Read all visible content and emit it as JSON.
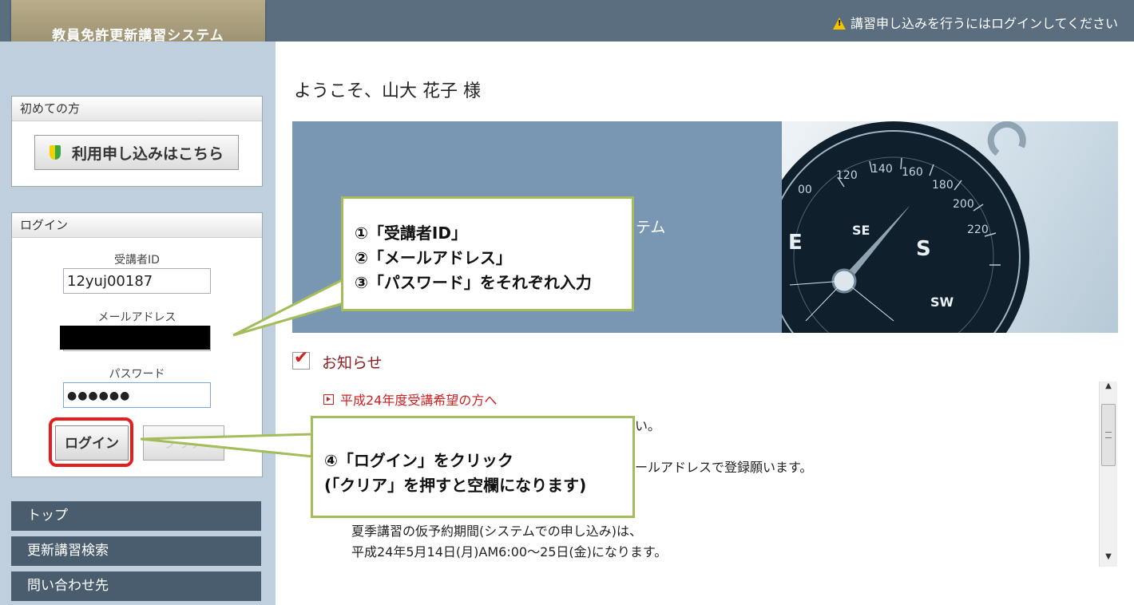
{
  "app": {
    "title": "教員免許更新講習システム"
  },
  "header": {
    "notice": "講習申し込みを行うにはログインしてください",
    "notice_icon": "warning-icon"
  },
  "sidebar": {
    "first_time": {
      "heading": "初めての方",
      "apply_button": "利用申し込みはこちら",
      "apply_icon": "beginner-mark-icon"
    },
    "login": {
      "heading": "ログイン",
      "id_label": "受講者ID",
      "id_value": "12yuj00187",
      "email_label": "メールアドレス",
      "email_value": "",
      "password_label": "パスワード",
      "password_value": "●●●●●●",
      "login_button": "ログイン",
      "clear_button": "クリア"
    },
    "nav": [
      "トップ",
      "更新講習検索",
      "問い合わせ先"
    ]
  },
  "main": {
    "welcome": "ようこそ、山大 花子 様",
    "hero_text": "テム",
    "info_title": "お知らせ",
    "news": {
      "link": "平成24年度受講希望の方へ",
      "lines": [
        "さい。",
        "。",
        "メールアドレスで登録願います。",
        "夏季講習の仮予約期間(システムでの申し込み)は、",
        "平成24年5月14日(月)AM6:00～25日(金)になります。"
      ]
    }
  },
  "callouts": {
    "first": [
      "①「受講者ID」",
      "②「メールアドレス」",
      "③「パスワード」をそれぞれ入力"
    ],
    "second": [
      "④「ログイン」をクリック",
      "(「クリア」を押すと空欄になります)"
    ]
  },
  "colors": {
    "accent_red": "#e51d1d",
    "callout_border": "#a3bd5a",
    "nav_bg": "#4a5d6f",
    "header_bg": "#5a6e80"
  }
}
